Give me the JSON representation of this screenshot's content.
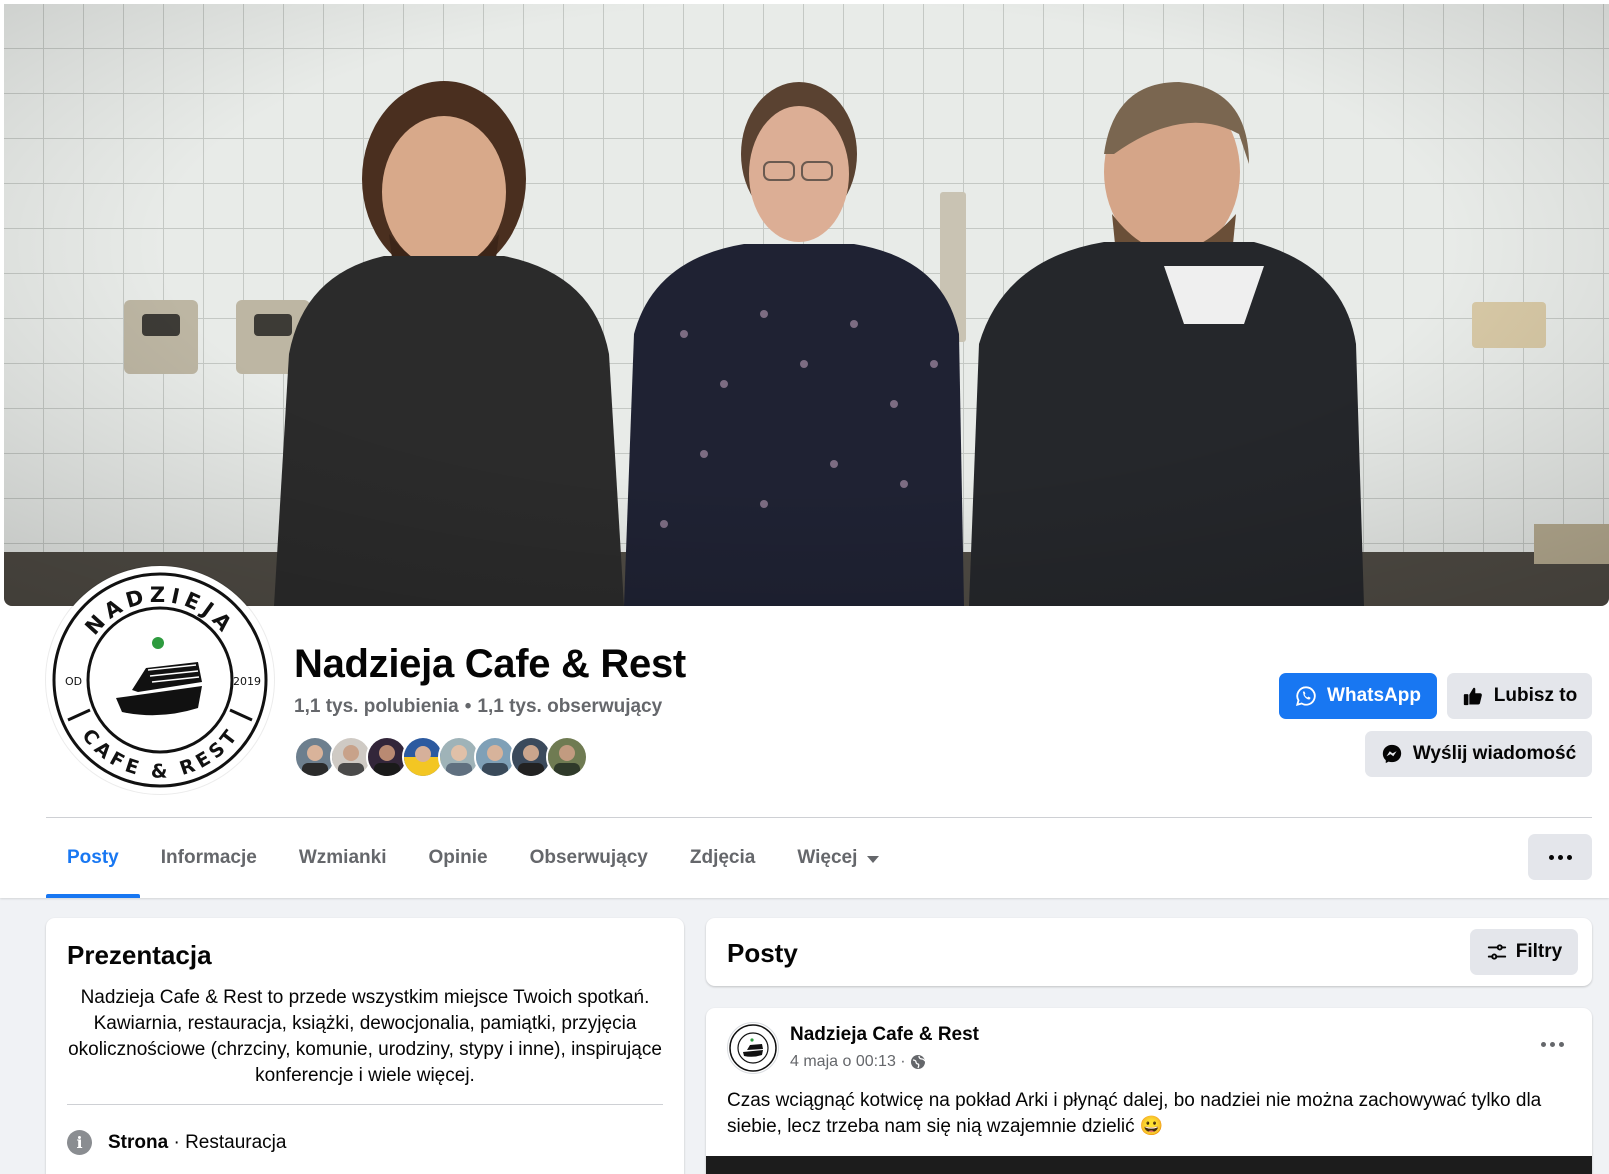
{
  "page": {
    "name": "Nadzieja Cafe & Rest",
    "likes": "1,1 tys. polubienia",
    "separator": "•",
    "followers": "1,1 tys. obserwujący"
  },
  "logo": {
    "top_text": "NADZIEJA",
    "bottom_text": "CAFE & REST",
    "left_text": "OD",
    "right_text": "2019"
  },
  "actions": {
    "whatsapp": "WhatsApp",
    "like": "Lubisz to",
    "message": "Wyślij wiadomość"
  },
  "tabs": [
    {
      "label": "Posty",
      "active": true
    },
    {
      "label": "Informacje"
    },
    {
      "label": "Wzmianki"
    },
    {
      "label": "Opinie"
    },
    {
      "label": "Obserwujący"
    },
    {
      "label": "Zdjęcia"
    },
    {
      "label": "Więcej"
    }
  ],
  "intro": {
    "title": "Prezentacja",
    "description": "Nadzieja Cafe & Rest to przede wszystkim miejsce Twoich spotkań. Kawiarnia, restauracja, książki, dewocjonalia, pamiątki, przyjęcia okolicznościowe (chrzciny, komunie, urodziny, stypy i inne), inspirujące konferencje i wiele więcej.",
    "category_label": "Strona",
    "category_value": " · Restauracja"
  },
  "posts": {
    "title": "Posty",
    "filter_label": "Filtry",
    "items": [
      {
        "author": "Nadzieja Cafe & Rest",
        "time": "4 maja o 00:13 ·",
        "text": "Czas wciągnąć kotwicę na pokład Arki i płynąć dalej, bo nadziei nie można zachowywać tylko dla siebie, lecz trzeba nam się nią wzajemnie dzielić 😀"
      }
    ]
  },
  "colors": {
    "accent": "#1877f2",
    "secondary_text": "#65676b",
    "button_gray": "#e4e6eb",
    "logo_green": "#2e9b3f"
  },
  "icons": [
    "whatsapp-icon",
    "thumbs-up-icon",
    "messenger-icon",
    "chevron-down-icon",
    "more-icon",
    "info-icon",
    "filter-icon",
    "globe-icon"
  ]
}
